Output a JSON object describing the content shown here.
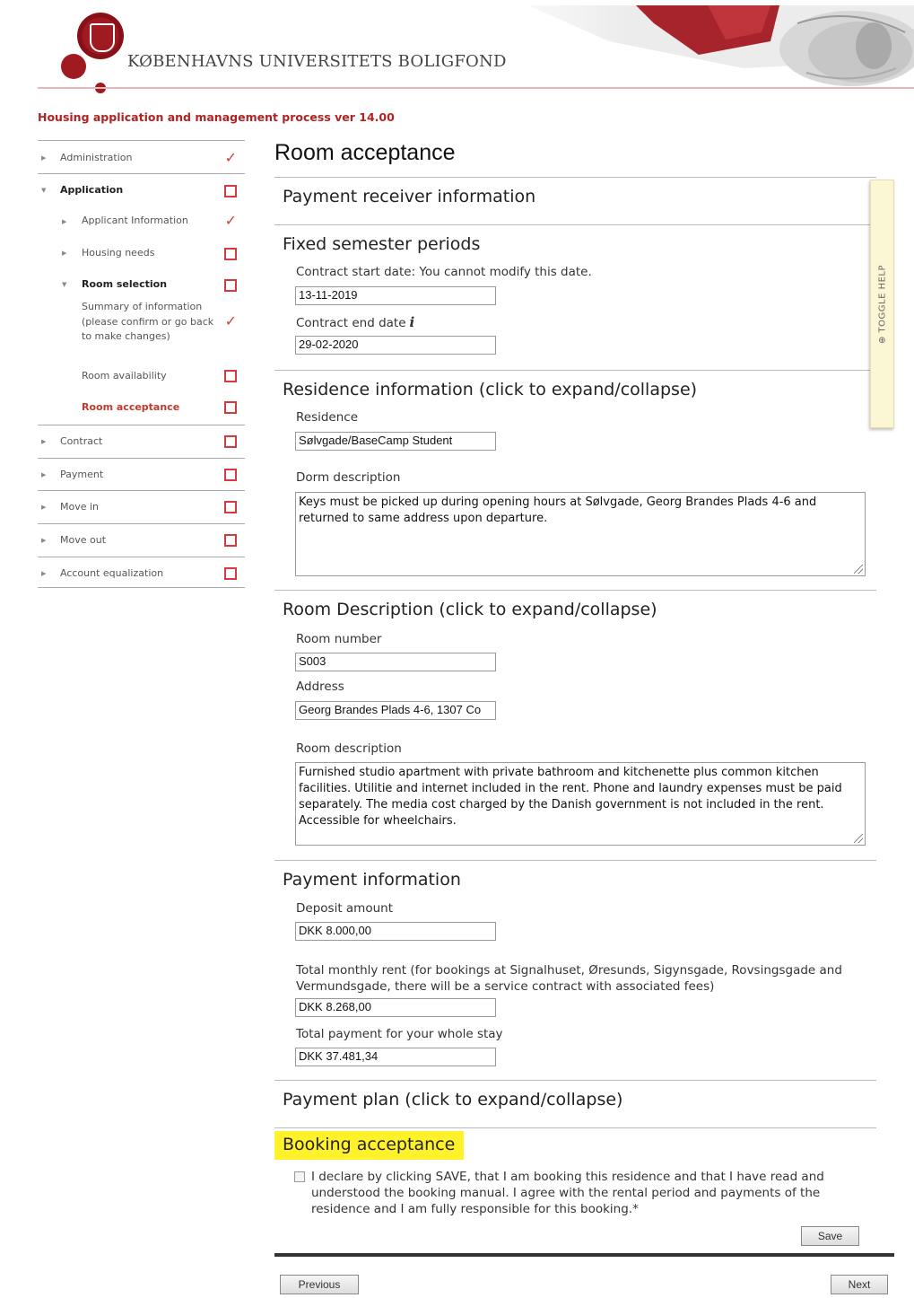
{
  "header": {
    "org_name": "KØBENHAVNS UNIVERSITETS BOLIGFOND",
    "process_title": "Housing application and management process ver 14.00"
  },
  "sidebar": {
    "items": [
      {
        "label": "Administration",
        "status": "done"
      },
      {
        "label": "Application",
        "status": "open"
      },
      {
        "label": "Applicant Information",
        "status": "done"
      },
      {
        "label": "Housing needs",
        "status": "open"
      },
      {
        "label": "Room selection",
        "status": "open"
      },
      {
        "label": "Summary of information (please confirm or go back to make changes)",
        "status": "done"
      },
      {
        "label": "Room availability",
        "status": "open"
      },
      {
        "label": "Room acceptance",
        "status": "open"
      },
      {
        "label": "Contract",
        "status": "open"
      },
      {
        "label": "Payment",
        "status": "open"
      },
      {
        "label": "Move in",
        "status": "open"
      },
      {
        "label": "Move out",
        "status": "open"
      },
      {
        "label": "Account equalization",
        "status": "open"
      }
    ]
  },
  "main": {
    "title": "Room acceptance",
    "payment_receiver": {
      "title": "Payment receiver information"
    },
    "semester": {
      "title": "Fixed semester periods",
      "start_label": "Contract start date: You cannot modify this date.",
      "start_value": "13-11-2019",
      "end_label": "Contract end date",
      "end_value": "29-02-2020"
    },
    "residence": {
      "title": "Residence information (click to expand/collapse)",
      "residence_label": "Residence",
      "residence_value": "Sølvgade/BaseCamp Student",
      "dorm_label": "Dorm description",
      "dorm_value": "Keys must be picked up during opening hours at Sølvgade, Georg Brandes Plads 4-6 and returned to same address upon departure."
    },
    "room": {
      "title": "Room Description (click to expand/collapse)",
      "number_label": "Room number",
      "number_value": "S003",
      "address_label": "Address",
      "address_value": "Georg Brandes Plads 4-6, 1307 Co",
      "desc_label": "Room description",
      "desc_value": "Furnished studio apartment with private bathroom and kitchenette plus common kitchen facilities. Utilitie and internet included in the rent. Phone and laundry expenses must be paid separately. The media cost charged by the Danish government is not included in the rent. Accessible for wheelchairs."
    },
    "payment": {
      "title": "Payment information",
      "deposit_label": "Deposit amount",
      "deposit_value": "DKK 8.000,00",
      "rent_label": "Total monthly rent (for bookings at Signalhuset, Øresunds, Sigynsgade, Rovsingsgade and Vermundsgade, there will be a service contract with associated fees)",
      "rent_value": "DKK 8.268,00",
      "total_label": "Total payment for your whole stay",
      "total_value": "DKK 37.481,34"
    },
    "plan": {
      "title": "Payment plan (click to expand/collapse)"
    },
    "booking": {
      "title": "Booking acceptance",
      "declaration": "I declare by clicking SAVE, that I am booking this residence and that I have read and understood the booking manual. I agree with the rental period and payments of the residence and I am fully responsible for this booking.*",
      "accepted": false
    },
    "toggle_help": "⊕ TOGGLE HELP",
    "buttons": {
      "save": "Save",
      "previous": "Previous",
      "next": "Next"
    }
  },
  "colors": {
    "accent_red": "#b22222",
    "highlight": "#fff22b",
    "help_panel": "#fbf6d3"
  }
}
